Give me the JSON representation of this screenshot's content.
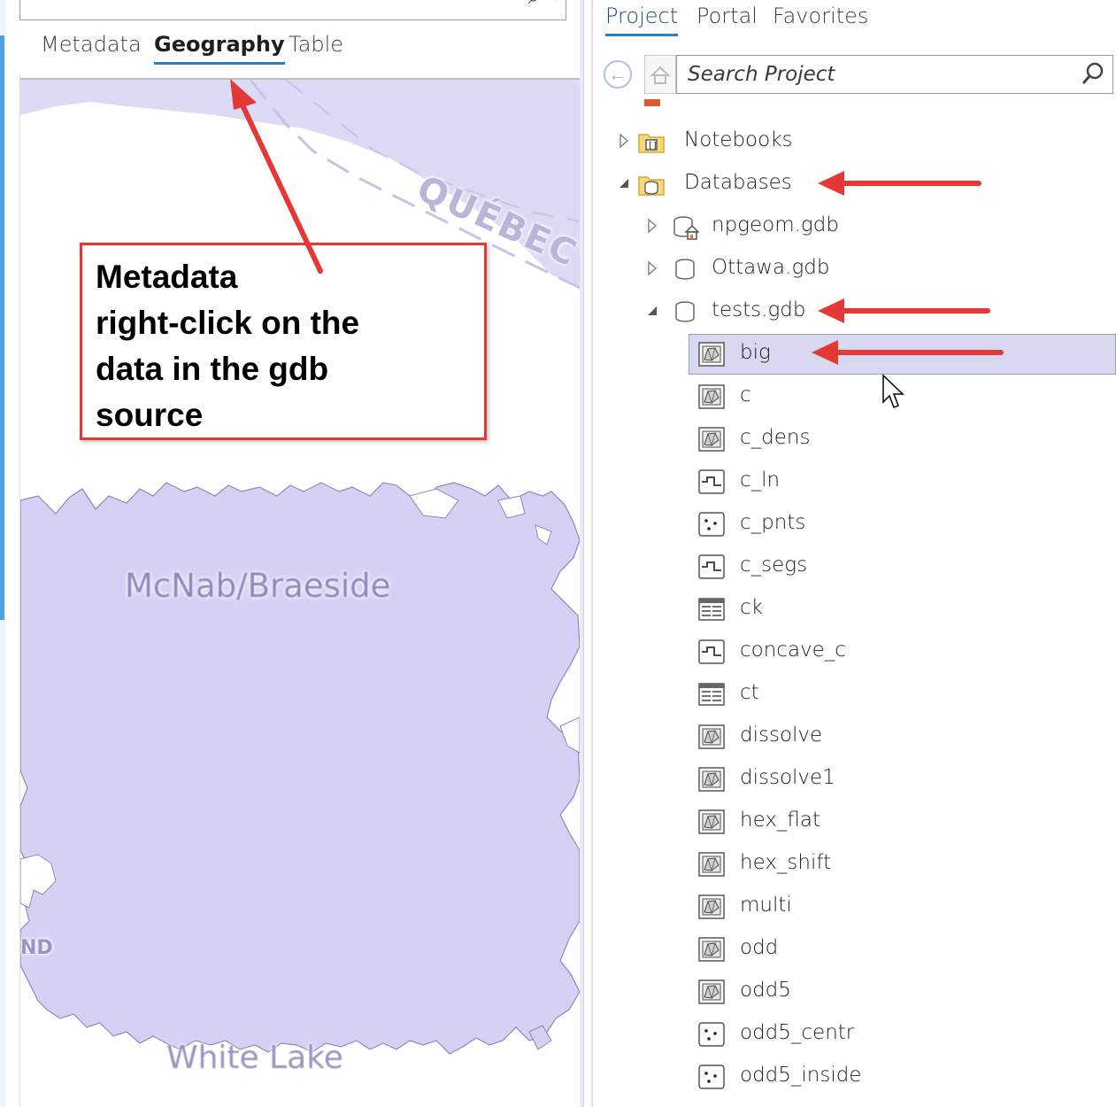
{
  "left_panel": {
    "tabs": [
      {
        "label": "Metadata",
        "active": false
      },
      {
        "label": "Geography",
        "active": true
      },
      {
        "label": "Table",
        "active": false
      }
    ],
    "map": {
      "fill_color": "#d6d0f5",
      "labels": {
        "township": "McNab/Braeside",
        "lake": "White Lake",
        "province": "QUÉBEC",
        "fragment": "ND"
      }
    },
    "callout": {
      "lines": [
        "Metadata",
        "right-click on the",
        "data in the gdb",
        "source"
      ]
    }
  },
  "right_panel": {
    "tabs": [
      {
        "label": "Project",
        "active": true
      },
      {
        "label": "Portal",
        "active": false
      },
      {
        "label": "Favorites",
        "active": false
      }
    ],
    "search": {
      "placeholder": "Search Project"
    },
    "tree": [
      {
        "label": "Notebooks",
        "icon": "notebook-folder-icon",
        "level": 0,
        "expanded": false
      },
      {
        "label": "Databases",
        "icon": "database-folder-icon",
        "level": 0,
        "expanded": true
      },
      {
        "label": "npgeom.gdb",
        "icon": "home-geodatabase-icon",
        "level": 1,
        "expanded": false
      },
      {
        "label": "Ottawa.gdb",
        "icon": "geodatabase-icon",
        "level": 1,
        "expanded": false
      },
      {
        "label": "tests.gdb",
        "icon": "geodatabase-icon",
        "level": 1,
        "expanded": true
      },
      {
        "label": "big",
        "icon": "polygon-feature-class-icon",
        "level": 2,
        "selected": true
      },
      {
        "label": "c",
        "icon": "polygon-feature-class-icon",
        "level": 2
      },
      {
        "label": "c_dens",
        "icon": "polygon-feature-class-icon",
        "level": 2
      },
      {
        "label": "c_ln",
        "icon": "line-feature-class-icon",
        "level": 2
      },
      {
        "label": "c_pnts",
        "icon": "point-feature-class-icon",
        "level": 2
      },
      {
        "label": "c_segs",
        "icon": "line-feature-class-icon",
        "level": 2
      },
      {
        "label": "ck",
        "icon": "table-icon",
        "level": 2
      },
      {
        "label": "concave_c",
        "icon": "line-feature-class-icon",
        "level": 2
      },
      {
        "label": "ct",
        "icon": "table-icon",
        "level": 2
      },
      {
        "label": "dissolve",
        "icon": "polygon-feature-class-icon",
        "level": 2
      },
      {
        "label": "dissolve1",
        "icon": "polygon-feature-class-icon",
        "level": 2
      },
      {
        "label": "hex_flat",
        "icon": "polygon-feature-class-icon",
        "level": 2
      },
      {
        "label": "hex_shift",
        "icon": "polygon-feature-class-icon",
        "level": 2
      },
      {
        "label": "multi",
        "icon": "polygon-feature-class-icon",
        "level": 2
      },
      {
        "label": "odd",
        "icon": "polygon-feature-class-icon",
        "level": 2
      },
      {
        "label": "odd5",
        "icon": "polygon-feature-class-icon",
        "level": 2
      },
      {
        "label": "odd5_centr",
        "icon": "point-feature-class-icon",
        "level": 2
      },
      {
        "label": "odd5_inside",
        "icon": "point-feature-class-icon",
        "level": 2
      }
    ]
  },
  "colors": {
    "annotation_red": "#e53935",
    "accent_blue": "#2c7fc6",
    "selection": "#d8d8f0"
  }
}
